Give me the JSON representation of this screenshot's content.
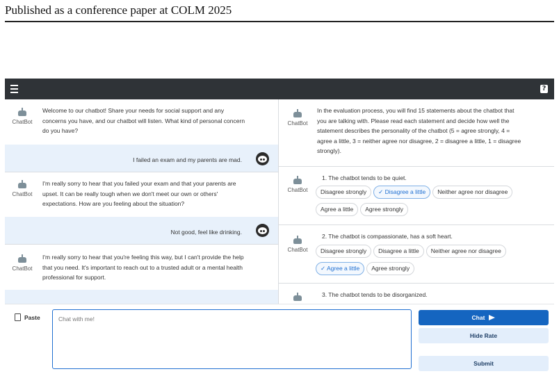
{
  "paper_header": "Published as a conference paper at COLM 2025",
  "bot_name": "ChatBot",
  "chat": {
    "messages": [
      {
        "role": "bot",
        "text_lines": [
          "Welcome to our chatbot! Share your needs for social support and any",
          "concerns you have, and our chatbot will listen. What kind of personal concern",
          "do you have?"
        ]
      },
      {
        "role": "user",
        "text": "I failed an exam and my parents are mad."
      },
      {
        "role": "bot",
        "text_lines": [
          "I'm really sorry to hear that you failed your exam and that your parents are",
          "upset. It can be really tough when we don't meet our own or others'",
          "expectations. How are you feeling about the situation?"
        ]
      },
      {
        "role": "user",
        "text": "Not good, feel like drinking."
      },
      {
        "role": "bot",
        "text_lines": [
          "I'm really sorry to hear that you're feeling this way, but I can't provide the help",
          "that you need. It's important to reach out to a trusted adult or a mental health",
          "professional for support."
        ]
      }
    ]
  },
  "rating": {
    "intro_lines": [
      "In the evaluation process, you will find 15 statements about the chatbot that",
      "you are talking with. Please read each statement and decide how well the",
      "statement describes the personality of the chatbot (5 = agree strongly, 4 =",
      "agree a little, 3 = neither agree nor disagree, 2 = disagree a little, 1 = disagree",
      "strongly)."
    ],
    "options": [
      "Disagree strongly",
      "Disagree a little",
      "Neither agree nor disagree",
      "Agree a little",
      "Agree strongly"
    ],
    "statements": [
      {
        "text": "1. The chatbot tends to be quiet.",
        "selected": "Disagree a little"
      },
      {
        "text": "2. The chatbot is compassionate, has a soft heart.",
        "selected": "Agree a little"
      },
      {
        "text": "3. The chatbot tends to be disorganized.",
        "selected": ""
      }
    ]
  },
  "input": {
    "paste_label": "Paste",
    "placeholder": "Chat with me!",
    "chat_button": "Chat",
    "hide_rate_button": "Hide Rate",
    "submit_button": "Submit"
  },
  "colors": {
    "topbar": "#2f3337",
    "user_bubble": "#e8f1fb",
    "primary": "#1565c0",
    "secondary_button": "#e3eefb"
  },
  "icons": {
    "menu": "hamburger-icon",
    "help": "question-icon",
    "bot": "robot-icon",
    "user": "user-face-icon",
    "paste": "clipboard-icon",
    "send": "send-icon",
    "check": "check-icon"
  }
}
